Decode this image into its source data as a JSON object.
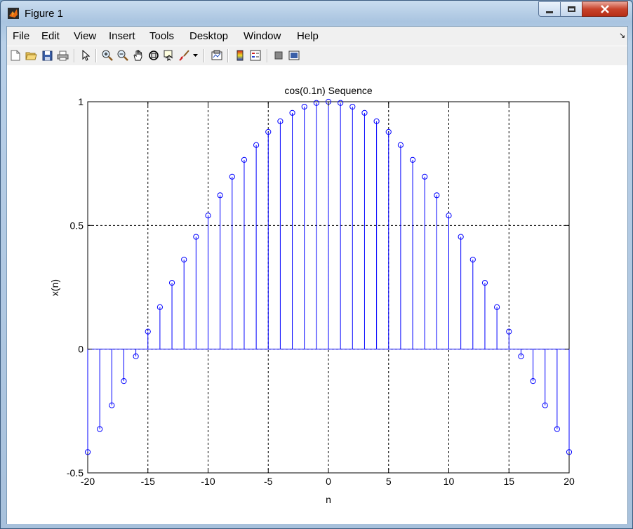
{
  "window": {
    "title": "Figure 1"
  },
  "menu": [
    "File",
    "Edit",
    "View",
    "Insert",
    "Tools",
    "Desktop",
    "Window",
    "Help"
  ],
  "toolbar_icons": [
    "new-figure-icon",
    "open-file-icon",
    "save-icon",
    "print-icon",
    "pointer-icon",
    "zoom-in-icon",
    "zoom-out-icon",
    "pan-hand-icon",
    "rotate-3d-icon",
    "data-cursor-icon",
    "brush-icon",
    "brush-dropdown-icon",
    "link-plot-icon",
    "colorbar-icon",
    "legend-icon",
    "hide-plot-tools-icon",
    "show-plot-tools-icon"
  ],
  "chart_data": {
    "type": "stem",
    "title": "cos(0.1n) Sequence",
    "xlabel": "n",
    "ylabel": "x(n)",
    "xlim": [
      -20,
      20
    ],
    "ylim": [
      -0.5,
      1
    ],
    "xticks": [
      -20,
      -15,
      -10,
      -5,
      0,
      5,
      10,
      15,
      20
    ],
    "yticks": [
      -0.5,
      0,
      0.5,
      1
    ],
    "xtick_labels": [
      "-20",
      "-15",
      "-10",
      "-5",
      "0",
      "5",
      "10",
      "15",
      "20"
    ],
    "ytick_labels": [
      "-0.5",
      "0",
      "0.5",
      "1"
    ],
    "grid": true,
    "color": "#0000ff",
    "x": [
      -20,
      -19,
      -18,
      -17,
      -16,
      -15,
      -14,
      -13,
      -12,
      -11,
      -10,
      -9,
      -8,
      -7,
      -6,
      -5,
      -4,
      -3,
      -2,
      -1,
      0,
      1,
      2,
      3,
      4,
      5,
      6,
      7,
      8,
      9,
      10,
      11,
      12,
      13,
      14,
      15,
      16,
      17,
      18,
      19,
      20
    ],
    "y": [
      -0.416,
      -0.323,
      -0.227,
      -0.129,
      -0.029,
      0.071,
      0.17,
      0.268,
      0.362,
      0.454,
      0.54,
      0.622,
      0.697,
      0.765,
      0.825,
      0.878,
      0.921,
      0.955,
      0.98,
      0.995,
      1.0,
      0.995,
      0.98,
      0.955,
      0.921,
      0.878,
      0.825,
      0.765,
      0.697,
      0.622,
      0.54,
      0.454,
      0.362,
      0.268,
      0.17,
      0.071,
      -0.029,
      -0.129,
      -0.227,
      -0.323,
      -0.416
    ]
  }
}
